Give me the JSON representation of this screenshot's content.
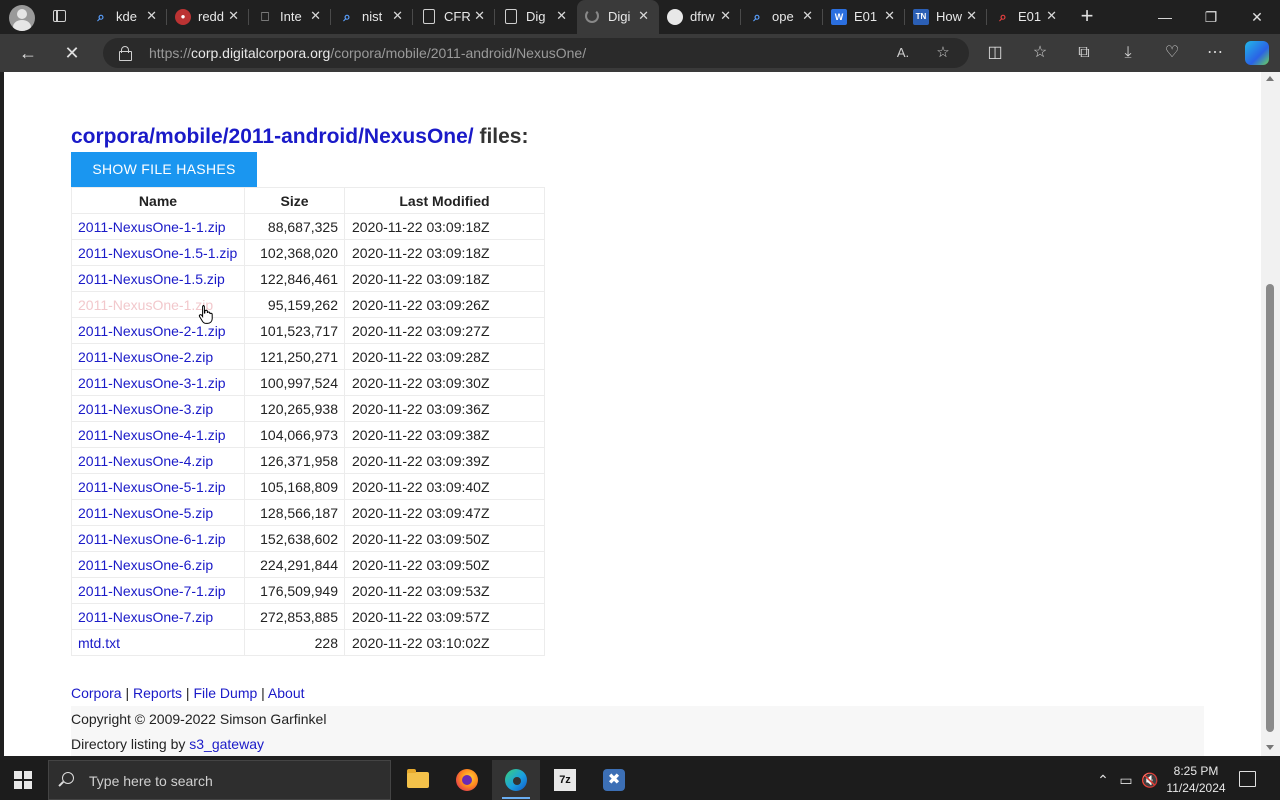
{
  "browser": {
    "tabs": [
      {
        "icon": "search-icon",
        "title": "kde",
        "active": false
      },
      {
        "icon": "reddit-icon",
        "title": "redd",
        "active": false
      },
      {
        "icon": "archive-icon",
        "title": "Inte",
        "active": false
      },
      {
        "icon": "search-icon",
        "title": "nist",
        "active": false
      },
      {
        "icon": "document-icon",
        "title": "CFR",
        "active": false
      },
      {
        "icon": "document-icon",
        "title": "Dig",
        "active": false
      },
      {
        "icon": "loading-icon",
        "title": "Digi",
        "active": true
      },
      {
        "icon": "github-icon",
        "title": "dfrw",
        "active": false
      },
      {
        "icon": "search-icon",
        "title": "ope",
        "active": false
      },
      {
        "icon": "word-icon",
        "title": "E01",
        "active": false
      },
      {
        "icon": "tn-icon",
        "title": "How",
        "active": false
      },
      {
        "icon": "search-red-icon",
        "title": "E01",
        "active": false
      }
    ],
    "url_protocol": "https://",
    "url_host": "corp.digitalcorpora.org",
    "url_path": "/corpora/mobile/2011-android/NexusOne/"
  },
  "page": {
    "heading_link": "corpora/mobile/2011-android/NexusOne/",
    "heading_suffix": " files:",
    "show_hashes_label": "SHOW FILE HASHES",
    "columns": {
      "name": "Name",
      "size": "Size",
      "modified": "Last Modified"
    },
    "files": [
      {
        "name": "2011-NexusOne-1-1.zip",
        "size": "88,687,325",
        "modified": "2020-11-22 03:09:18Z"
      },
      {
        "name": "2011-NexusOne-1.5-1.zip",
        "size": "102,368,020",
        "modified": "2020-11-22 03:09:18Z"
      },
      {
        "name": "2011-NexusOne-1.5.zip",
        "size": "122,846,461",
        "modified": "2020-11-22 03:09:18Z"
      },
      {
        "name": "2011-NexusOne-1.zip",
        "size": "95,159,262",
        "modified": "2020-11-22 03:09:26Z"
      },
      {
        "name": "2011-NexusOne-2-1.zip",
        "size": "101,523,717",
        "modified": "2020-11-22 03:09:27Z"
      },
      {
        "name": "2011-NexusOne-2.zip",
        "size": "121,250,271",
        "modified": "2020-11-22 03:09:28Z"
      },
      {
        "name": "2011-NexusOne-3-1.zip",
        "size": "100,997,524",
        "modified": "2020-11-22 03:09:30Z"
      },
      {
        "name": "2011-NexusOne-3.zip",
        "size": "120,265,938",
        "modified": "2020-11-22 03:09:36Z"
      },
      {
        "name": "2011-NexusOne-4-1.zip",
        "size": "104,066,973",
        "modified": "2020-11-22 03:09:38Z"
      },
      {
        "name": "2011-NexusOne-4.zip",
        "size": "126,371,958",
        "modified": "2020-11-22 03:09:39Z"
      },
      {
        "name": "2011-NexusOne-5-1.zip",
        "size": "105,168,809",
        "modified": "2020-11-22 03:09:40Z"
      },
      {
        "name": "2011-NexusOne-5.zip",
        "size": "128,566,187",
        "modified": "2020-11-22 03:09:47Z"
      },
      {
        "name": "2011-NexusOne-6-1.zip",
        "size": "152,638,602",
        "modified": "2020-11-22 03:09:50Z"
      },
      {
        "name": "2011-NexusOne-6.zip",
        "size": "224,291,844",
        "modified": "2020-11-22 03:09:50Z"
      },
      {
        "name": "2011-NexusOne-7-1.zip",
        "size": "176,509,949",
        "modified": "2020-11-22 03:09:53Z"
      },
      {
        "name": "2011-NexusOne-7.zip",
        "size": "272,853,885",
        "modified": "2020-11-22 03:09:57Z"
      },
      {
        "name": "mtd.txt",
        "size": "228",
        "modified": "2020-11-22 03:10:02Z"
      }
    ],
    "footer_links": [
      "Corpora",
      "Reports",
      "File Dump",
      "About"
    ],
    "footer_sep": " | ",
    "copyright": "Copyright © 2009-2022 Simson Garfinkel",
    "dir_listing_prefix": "Directory listing by ",
    "dir_listing_link": "s3_gateway"
  },
  "taskbar": {
    "search_placeholder": "Type here to search",
    "time": "8:25 PM",
    "date": "11/24/2024"
  },
  "colors": {
    "link": "#1a1ac8",
    "button": "#1a96f0",
    "hovered_link": "#f2c8cc"
  }
}
